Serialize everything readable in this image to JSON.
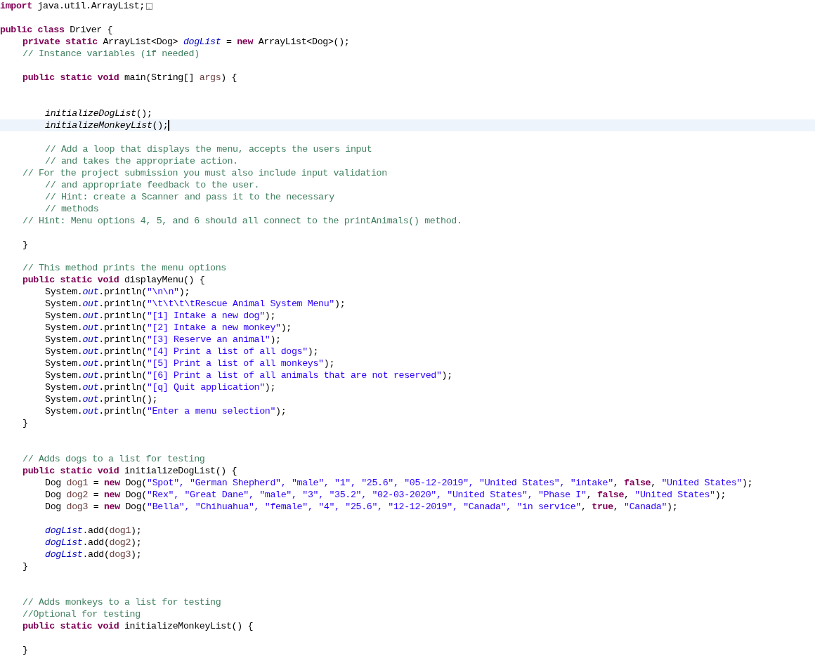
{
  "editor": {
    "lines": [
      {
        "kind": "top",
        "folded": true,
        "tokens": [
          {
            "kind": "keyword",
            "text": "import"
          },
          {
            "kind": "plain",
            "text": " java.util.ArrayList;"
          }
        ]
      },
      {
        "kind": "blank"
      },
      {
        "kind": "top",
        "tokens": [
          {
            "kind": "keyword",
            "text": "public class"
          },
          {
            "kind": "plain",
            "text": " Driver {"
          }
        ]
      },
      {
        "kind": "member",
        "tokens": [
          {
            "kind": "keyword",
            "text": "private static"
          },
          {
            "kind": "plain",
            "text": " ArrayList<Dog> "
          },
          {
            "kind": "field",
            "text": "dogList"
          },
          {
            "kind": "plain",
            "text": " = "
          },
          {
            "kind": "keyword",
            "text": "new"
          },
          {
            "kind": "plain",
            "text": " ArrayList<Dog>();"
          }
        ]
      },
      {
        "kind": "member",
        "tokens": [
          {
            "kind": "comment",
            "text": "// Instance variables (if needed)"
          }
        ]
      },
      {
        "kind": "blank"
      },
      {
        "kind": "member",
        "tokens": [
          {
            "kind": "keyword",
            "text": "public static void"
          },
          {
            "kind": "plain",
            "text": " main(String[] "
          },
          {
            "kind": "variable",
            "text": "args"
          },
          {
            "kind": "plain",
            "text": ") {"
          }
        ]
      },
      {
        "kind": "blank"
      },
      {
        "kind": "blank"
      },
      {
        "kind": "body",
        "tokens": [
          {
            "kind": "static_call",
            "text": "initializeDogList"
          },
          {
            "kind": "plain",
            "text": "();"
          }
        ]
      },
      {
        "kind": "body",
        "current": true,
        "tokens": [
          {
            "kind": "static_call",
            "text": "initializeMonkeyList"
          },
          {
            "kind": "plain",
            "text": "();"
          }
        ]
      },
      {
        "kind": "blank"
      },
      {
        "kind": "body",
        "tokens": [
          {
            "kind": "comment",
            "text": "// Add a loop that displays the menu, accepts the users input"
          }
        ]
      },
      {
        "kind": "body",
        "tokens": [
          {
            "kind": "comment",
            "text": "// and takes the appropriate action."
          }
        ]
      },
      {
        "kind": "member",
        "tokens": [
          {
            "kind": "comment",
            "text": "// For the project submission you must also include input validation"
          }
        ]
      },
      {
        "kind": "body",
        "tokens": [
          {
            "kind": "comment",
            "text": "// and appropriate feedback to the user."
          }
        ]
      },
      {
        "kind": "body",
        "tokens": [
          {
            "kind": "comment",
            "text": "// Hint: create a Scanner and pass it to the necessary"
          }
        ]
      },
      {
        "kind": "body",
        "tokens": [
          {
            "kind": "comment",
            "text": "// methods"
          }
        ]
      },
      {
        "kind": "member",
        "tokens": [
          {
            "kind": "comment",
            "text": "// Hint: Menu options 4, 5, and 6 should all connect to the printAnimals() method."
          }
        ]
      },
      {
        "kind": "blank"
      },
      {
        "kind": "member",
        "tokens": [
          {
            "kind": "plain",
            "text": "}"
          }
        ]
      },
      {
        "kind": "blank"
      },
      {
        "kind": "member",
        "tokens": [
          {
            "kind": "comment",
            "text": "// This method prints the menu options"
          }
        ]
      },
      {
        "kind": "member",
        "tokens": [
          {
            "kind": "keyword",
            "text": "public static void"
          },
          {
            "kind": "plain",
            "text": " displayMenu() {"
          }
        ]
      },
      {
        "kind": "body",
        "tokens": [
          {
            "kind": "plain",
            "text": "System."
          },
          {
            "kind": "field",
            "text": "out"
          },
          {
            "kind": "plain",
            "text": ".println("
          },
          {
            "kind": "string",
            "text": "\"\\n\\n\""
          },
          {
            "kind": "plain",
            "text": ");"
          }
        ]
      },
      {
        "kind": "body",
        "tokens": [
          {
            "kind": "plain",
            "text": "System."
          },
          {
            "kind": "field",
            "text": "out"
          },
          {
            "kind": "plain",
            "text": ".println("
          },
          {
            "kind": "string",
            "text": "\"\\t\\t\\t\\tRescue Animal System Menu\""
          },
          {
            "kind": "plain",
            "text": ");"
          }
        ]
      },
      {
        "kind": "body",
        "tokens": [
          {
            "kind": "plain",
            "text": "System."
          },
          {
            "kind": "field",
            "text": "out"
          },
          {
            "kind": "plain",
            "text": ".println("
          },
          {
            "kind": "string",
            "text": "\"[1] Intake a new dog\""
          },
          {
            "kind": "plain",
            "text": ");"
          }
        ]
      },
      {
        "kind": "body",
        "tokens": [
          {
            "kind": "plain",
            "text": "System."
          },
          {
            "kind": "field",
            "text": "out"
          },
          {
            "kind": "plain",
            "text": ".println("
          },
          {
            "kind": "string",
            "text": "\"[2] Intake a new monkey\""
          },
          {
            "kind": "plain",
            "text": ");"
          }
        ]
      },
      {
        "kind": "body",
        "tokens": [
          {
            "kind": "plain",
            "text": "System."
          },
          {
            "kind": "field",
            "text": "out"
          },
          {
            "kind": "plain",
            "text": ".println("
          },
          {
            "kind": "string",
            "text": "\"[3] Reserve an animal\""
          },
          {
            "kind": "plain",
            "text": ");"
          }
        ]
      },
      {
        "kind": "body",
        "tokens": [
          {
            "kind": "plain",
            "text": "System."
          },
          {
            "kind": "field",
            "text": "out"
          },
          {
            "kind": "plain",
            "text": ".println("
          },
          {
            "kind": "string",
            "text": "\"[4] Print a list of all dogs\""
          },
          {
            "kind": "plain",
            "text": ");"
          }
        ]
      },
      {
        "kind": "body",
        "tokens": [
          {
            "kind": "plain",
            "text": "System."
          },
          {
            "kind": "field",
            "text": "out"
          },
          {
            "kind": "plain",
            "text": ".println("
          },
          {
            "kind": "string",
            "text": "\"[5] Print a list of all monkeys\""
          },
          {
            "kind": "plain",
            "text": ");"
          }
        ]
      },
      {
        "kind": "body",
        "tokens": [
          {
            "kind": "plain",
            "text": "System."
          },
          {
            "kind": "field",
            "text": "out"
          },
          {
            "kind": "plain",
            "text": ".println("
          },
          {
            "kind": "string",
            "text": "\"[6] Print a list of all animals that are not reserved\""
          },
          {
            "kind": "plain",
            "text": ");"
          }
        ]
      },
      {
        "kind": "body",
        "tokens": [
          {
            "kind": "plain",
            "text": "System."
          },
          {
            "kind": "field",
            "text": "out"
          },
          {
            "kind": "plain",
            "text": ".println("
          },
          {
            "kind": "string",
            "text": "\"[q] Quit application\""
          },
          {
            "kind": "plain",
            "text": ");"
          }
        ]
      },
      {
        "kind": "body",
        "tokens": [
          {
            "kind": "plain",
            "text": "System."
          },
          {
            "kind": "field",
            "text": "out"
          },
          {
            "kind": "plain",
            "text": ".println();"
          }
        ]
      },
      {
        "kind": "body",
        "tokens": [
          {
            "kind": "plain",
            "text": "System."
          },
          {
            "kind": "field",
            "text": "out"
          },
          {
            "kind": "plain",
            "text": ".println("
          },
          {
            "kind": "string",
            "text": "\"Enter a menu selection\""
          },
          {
            "kind": "plain",
            "text": ");"
          }
        ]
      },
      {
        "kind": "member",
        "tokens": [
          {
            "kind": "plain",
            "text": "}"
          }
        ]
      },
      {
        "kind": "blank"
      },
      {
        "kind": "blank"
      },
      {
        "kind": "member",
        "tokens": [
          {
            "kind": "comment",
            "text": "// Adds dogs to a list for testing"
          }
        ]
      },
      {
        "kind": "member",
        "tokens": [
          {
            "kind": "keyword",
            "text": "public static void"
          },
          {
            "kind": "plain",
            "text": " initializeDogList() {"
          }
        ]
      },
      {
        "kind": "body",
        "tokens": [
          {
            "kind": "plain",
            "text": "Dog "
          },
          {
            "kind": "variable",
            "text": "dog1"
          },
          {
            "kind": "plain",
            "text": " = "
          },
          {
            "kind": "keyword",
            "text": "new"
          },
          {
            "kind": "plain",
            "text": " Dog("
          },
          {
            "kind": "string",
            "text": "\"Spot\", \"German Shepherd\", \"male\", \"1\", \"25.6\", \"05-12-2019\", \"United States\", \"intake\""
          },
          {
            "kind": "plain",
            "text": ", "
          },
          {
            "kind": "keyword",
            "text": "false"
          },
          {
            "kind": "plain",
            "text": ", "
          },
          {
            "kind": "string",
            "text": "\"United States\""
          },
          {
            "kind": "plain",
            "text": ");"
          }
        ]
      },
      {
        "kind": "body",
        "tokens": [
          {
            "kind": "plain",
            "text": "Dog "
          },
          {
            "kind": "variable",
            "text": "dog2"
          },
          {
            "kind": "plain",
            "text": " = "
          },
          {
            "kind": "keyword",
            "text": "new"
          },
          {
            "kind": "plain",
            "text": " Dog("
          },
          {
            "kind": "string",
            "text": "\"Rex\", \"Great Dane\", \"male\", \"3\", \"35.2\", \"02-03-2020\", \"United States\", \"Phase I\""
          },
          {
            "kind": "plain",
            "text": ", "
          },
          {
            "kind": "keyword",
            "text": "false"
          },
          {
            "kind": "plain",
            "text": ", "
          },
          {
            "kind": "string",
            "text": "\"United States\""
          },
          {
            "kind": "plain",
            "text": ");"
          }
        ]
      },
      {
        "kind": "body",
        "tokens": [
          {
            "kind": "plain",
            "text": "Dog "
          },
          {
            "kind": "variable",
            "text": "dog3"
          },
          {
            "kind": "plain",
            "text": " = "
          },
          {
            "kind": "keyword",
            "text": "new"
          },
          {
            "kind": "plain",
            "text": " Dog("
          },
          {
            "kind": "string",
            "text": "\"Bella\", \"Chihuahua\", \"female\", \"4\", \"25.6\", \"12-12-2019\", \"Canada\", \"in service\""
          },
          {
            "kind": "plain",
            "text": ", "
          },
          {
            "kind": "keyword",
            "text": "true"
          },
          {
            "kind": "plain",
            "text": ", "
          },
          {
            "kind": "string",
            "text": "\"Canada\""
          },
          {
            "kind": "plain",
            "text": ");"
          }
        ]
      },
      {
        "kind": "blank"
      },
      {
        "kind": "body",
        "tokens": [
          {
            "kind": "field",
            "text": "dogList"
          },
          {
            "kind": "plain",
            "text": ".add("
          },
          {
            "kind": "variable",
            "text": "dog1"
          },
          {
            "kind": "plain",
            "text": ");"
          }
        ]
      },
      {
        "kind": "body",
        "tokens": [
          {
            "kind": "field",
            "text": "dogList"
          },
          {
            "kind": "plain",
            "text": ".add("
          },
          {
            "kind": "variable",
            "text": "dog2"
          },
          {
            "kind": "plain",
            "text": ");"
          }
        ]
      },
      {
        "kind": "body",
        "tokens": [
          {
            "kind": "field",
            "text": "dogList"
          },
          {
            "kind": "plain",
            "text": ".add("
          },
          {
            "kind": "variable",
            "text": "dog3"
          },
          {
            "kind": "plain",
            "text": ");"
          }
        ]
      },
      {
        "kind": "member",
        "tokens": [
          {
            "kind": "plain",
            "text": "}"
          }
        ]
      },
      {
        "kind": "blank"
      },
      {
        "kind": "blank"
      },
      {
        "kind": "member",
        "tokens": [
          {
            "kind": "comment",
            "text": "// Adds monkeys to a list for testing"
          }
        ]
      },
      {
        "kind": "member",
        "tokens": [
          {
            "kind": "comment",
            "text": "//Optional for testing"
          }
        ]
      },
      {
        "kind": "member",
        "tokens": [
          {
            "kind": "keyword",
            "text": "public static void"
          },
          {
            "kind": "plain",
            "text": " initializeMonkeyList() {"
          }
        ]
      },
      {
        "kind": "blank"
      },
      {
        "kind": "member",
        "tokens": [
          {
            "kind": "plain",
            "text": "}"
          }
        ]
      }
    ]
  }
}
